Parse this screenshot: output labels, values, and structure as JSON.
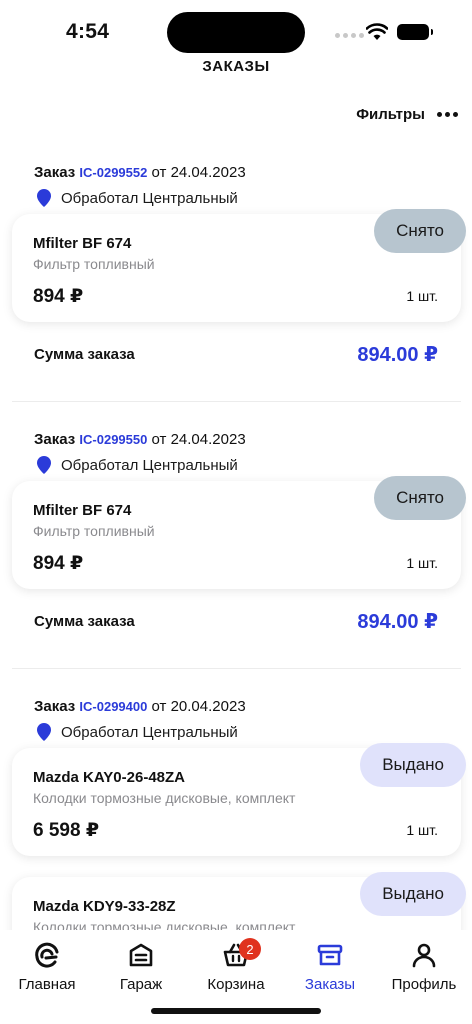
{
  "status_bar": {
    "time": "4:54"
  },
  "header": {
    "title": "ЗАКАЗЫ",
    "filters_label": "Фильтры"
  },
  "orders": [
    {
      "order_word": "Заказ",
      "number": "IC-0299552",
      "date_text": "от 24.04.2023",
      "office": "Обработал Центральный",
      "item": {
        "name": "Mfilter BF 674",
        "description": "Фильтр топливный",
        "price": "894 ₽",
        "qty": "1 шт.",
        "status": "Снято"
      },
      "sum_label": "Сумма заказа",
      "sum_value": "894.00 ₽"
    },
    {
      "order_word": "Заказ",
      "number": "IC-0299550",
      "date_text": "от 24.04.2023",
      "office": "Обработал Центральный",
      "item": {
        "name": "Mfilter BF 674",
        "description": "Фильтр топливный",
        "price": "894 ₽",
        "qty": "1 шт.",
        "status": "Снято"
      },
      "sum_label": "Сумма заказа",
      "sum_value": "894.00 ₽"
    },
    {
      "order_word": "Заказ",
      "number": "IC-0299400",
      "date_text": "от 20.04.2023",
      "office": "Обработал Центральный",
      "items": [
        {
          "name": "Mazda KAY0-26-48ZA",
          "description": "Колодки тормозные дисковые, комплект",
          "price": "6 598 ₽",
          "qty": "1 шт.",
          "status": "Выдано"
        },
        {
          "name": "Mazda KDY9-33-28Z",
          "description": "Колодки тормозные дисковые, комплект",
          "status": "Выдано"
        }
      ]
    }
  ],
  "tab_bar": {
    "tabs": [
      {
        "label": "Главная",
        "icon": "home-logo-icon"
      },
      {
        "label": "Гараж",
        "icon": "garage-icon"
      },
      {
        "label": "Корзина",
        "icon": "basket-icon",
        "badge": "2"
      },
      {
        "label": "Заказы",
        "icon": "orders-box-icon",
        "active": true
      },
      {
        "label": "Профиль",
        "icon": "profile-icon"
      }
    ]
  },
  "colors": {
    "accent": "#2b3bd9",
    "status_removed": "#b7c5cf",
    "status_issued": "#e0e2fb",
    "badge_red": "#e0321e"
  }
}
